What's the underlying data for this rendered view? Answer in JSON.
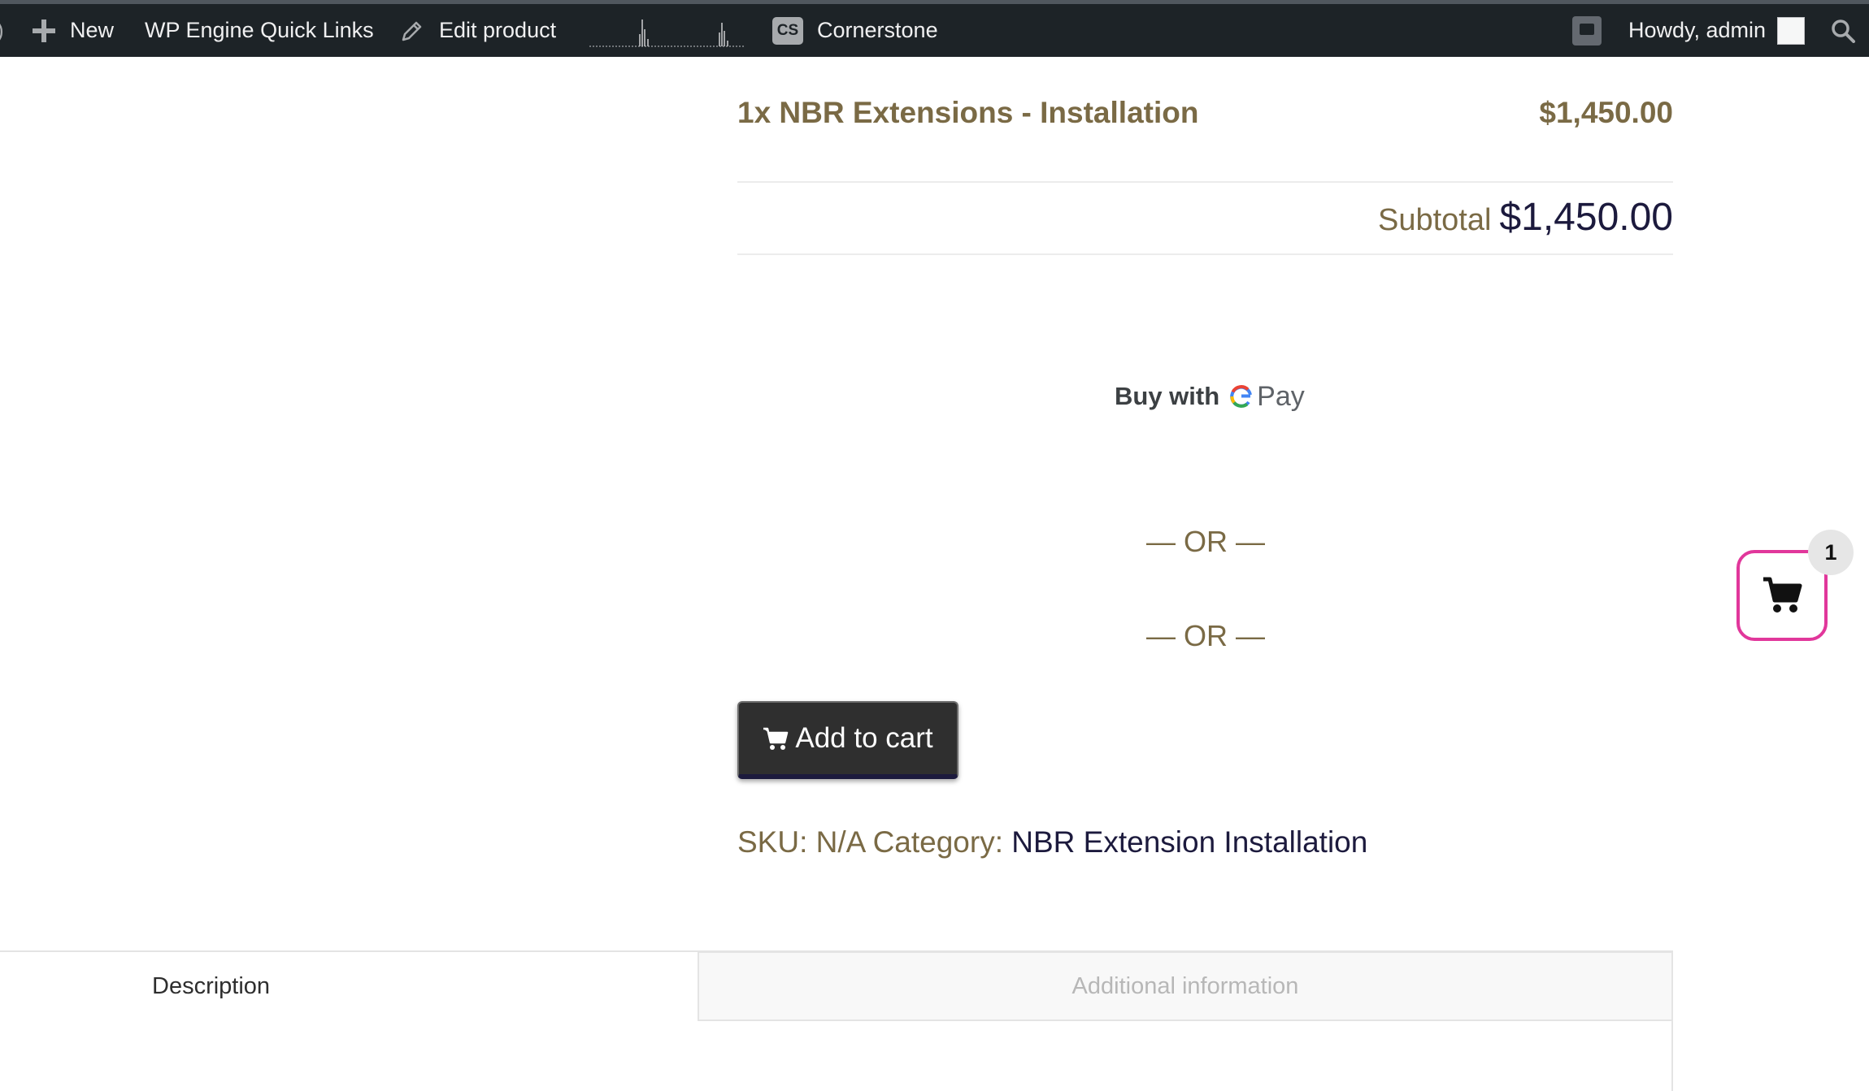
{
  "admin_bar": {
    "new_label": "New",
    "quick_links_label": "WP Engine Quick Links",
    "edit_product_label": "Edit product",
    "cs_badge": "CS",
    "cornerstone_label": "Cornerstone",
    "howdy_label": "Howdy, admin"
  },
  "order": {
    "line_item": "1x NBR Extensions - Installation",
    "line_price": "$1,450.00",
    "subtotal_label": "Subtotal",
    "subtotal_value": "$1,450.00"
  },
  "gpay": {
    "buy_with": "Buy with",
    "g": "G",
    "pay": "Pay"
  },
  "separators": {
    "or_1": "— OR —",
    "or_2": "— OR —"
  },
  "cart_button": {
    "label": "Add to cart"
  },
  "product_meta": {
    "sku_label": "SKU:",
    "sku_value": "N/A",
    "category_label": "Category:",
    "category_value": "NBR Extension Installation"
  },
  "tabs": [
    {
      "label": "Description",
      "active": true
    },
    {
      "label": "Additional information",
      "active": false
    }
  ],
  "floating_cart": {
    "count": "1"
  },
  "colors": {
    "admin_bar": "#1d2327",
    "accent_text": "#7a6a45",
    "dark_navy": "#1c1a3d",
    "cart_border": "#e1379b"
  }
}
